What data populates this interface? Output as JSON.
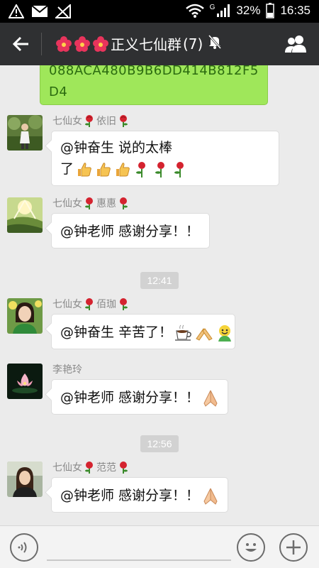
{
  "status_bar": {
    "network_type": "G",
    "battery": "32%",
    "time": "16:35",
    "icons": [
      "alert-icon",
      "mail-icon",
      "no-signal-icon",
      "wifi-icon",
      "signal-icon",
      "battery-icon"
    ]
  },
  "header": {
    "title": "正义七仙群",
    "member_count": "(7)",
    "title_prefix_icons": [
      "flower-icon",
      "flower-icon",
      "flower-icon"
    ],
    "muted_icon": "mute-bell-icon",
    "back_icon": "back-arrow-icon",
    "group_icon": "group-members-icon"
  },
  "colors": {
    "status_bar_bg": "#000000",
    "title_bar_bg": "#2f3032",
    "chat_bg": "#ebebeb",
    "own_bubble": "#9fe75a",
    "own_text": "#2b6b10",
    "timestamp_bg": "#d2d2d2"
  },
  "messages": {
    "own_partial": "088ACA480B9B6DD414B812F5D4",
    "m1": {
      "sender_prefix": "七仙女",
      "sender_name": "依旧",
      "text_line1": "@钟奋生 说的太棒",
      "text_line2": "了",
      "emojis": [
        "thumbs-up",
        "thumbs-up",
        "thumbs-up",
        "rose",
        "rose",
        "rose"
      ]
    },
    "m2": {
      "sender_prefix": "七仙女",
      "sender_name": "惠惠",
      "text": "@钟老师 感谢分享！！"
    },
    "time1": "12:41",
    "m3": {
      "sender_prefix": "七仙女",
      "sender_name": "佰珈",
      "text": "@钟奋生 辛苦了！",
      "emojis": [
        "coffee",
        "bow",
        "smiley-character"
      ]
    },
    "m4": {
      "sender_name": "李艳玲",
      "text": "@钟老师 感谢分享！！",
      "emojis": [
        "praying-hands"
      ]
    },
    "time2": "12:56",
    "m5": {
      "sender_prefix": "七仙女",
      "sender_name": "范范",
      "text": "@钟老师 感谢分享！！",
      "emojis": [
        "praying-hands"
      ]
    }
  },
  "bottom_bar": {
    "voice_icon": "voice-icon",
    "emoji_icon": "emoji-icon",
    "plus_icon": "plus-icon"
  }
}
